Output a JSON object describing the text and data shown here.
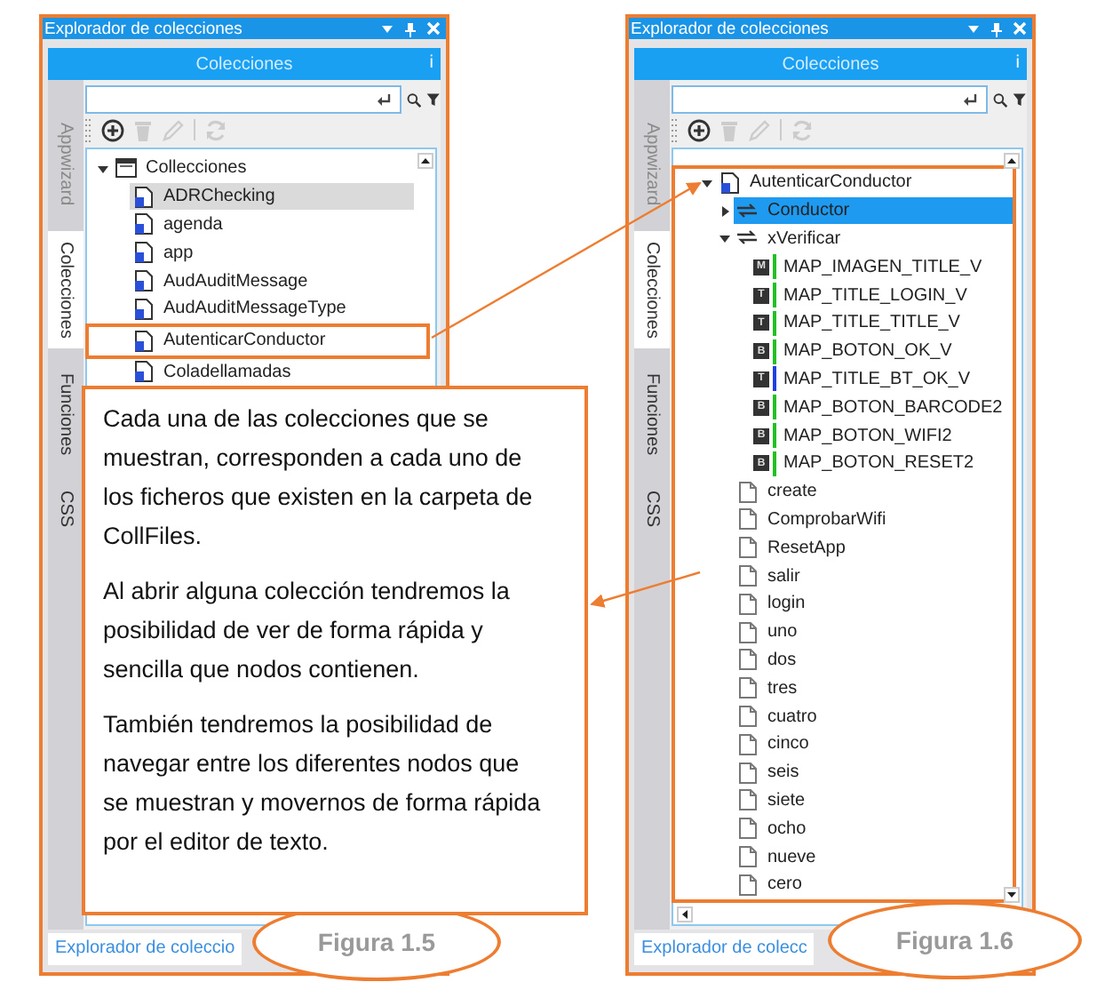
{
  "panels": [
    {
      "title": "Explorador de colecciones",
      "header": "Colecciones",
      "header_info": "i",
      "side_tabs": [
        {
          "label": "Appwizard",
          "selected": false,
          "disabled": true
        },
        {
          "label": "Colecciones",
          "selected": true,
          "disabled": false
        },
        {
          "label": "Funciones",
          "selected": false,
          "disabled": false
        },
        {
          "label": "CSS",
          "selected": false,
          "disabled": false
        }
      ],
      "list_focused": false,
      "tree": [
        {
          "label": "Collecciones",
          "kind": "collection",
          "expanded": true,
          "selected": false,
          "children": [
            {
              "label": "ADRChecking",
              "kind": "document",
              "selected": true
            },
            {
              "label": "agenda",
              "kind": "document",
              "selected": false
            },
            {
              "label": "app",
              "kind": "document",
              "selected": false
            },
            {
              "label": "AudAuditMessage",
              "kind": "document",
              "selected": false
            },
            {
              "label": "AudAuditMessageType",
              "kind": "document",
              "selected": false
            },
            {
              "label": "AutenticarConductor",
              "kind": "document",
              "selected": false,
              "highlighted": true
            },
            {
              "label": "Coladellamadas",
              "kind": "document",
              "selected": false
            }
          ]
        }
      ],
      "footer_tab": "Explorador de coleccio",
      "figure_label": "Figura 1.5"
    },
    {
      "title": "Explorador de colecciones",
      "header": "Colecciones",
      "header_info": "i",
      "side_tabs": [
        {
          "label": "Appwizard",
          "selected": false,
          "disabled": true
        },
        {
          "label": "Colecciones",
          "selected": true,
          "disabled": false
        },
        {
          "label": "Funciones",
          "selected": false,
          "disabled": false
        },
        {
          "label": "CSS",
          "selected": false,
          "disabled": false
        }
      ],
      "list_focused": true,
      "tree": [
        {
          "label": "AutenticarConductor",
          "kind": "document",
          "expanded": true,
          "selected": false,
          "highlighted": true,
          "children": [
            {
              "label": "Conductor",
              "kind": "node",
              "expanded": false,
              "selected": true
            },
            {
              "label": "xVerificar",
              "kind": "node",
              "expanded": true,
              "selected": false,
              "children": [
                {
                  "label": "MAP_IMAGEN_TITLE_V",
                  "kind": "map",
                  "badge": "M",
                  "color": "#22c022",
                  "selected": false
                },
                {
                  "label": "MAP_TITLE_LOGIN_V",
                  "kind": "map",
                  "badge": "T",
                  "color": "#22c022",
                  "selected": false
                },
                {
                  "label": "MAP_TITLE_TITLE_V",
                  "kind": "map",
                  "badge": "T",
                  "color": "#22c022",
                  "selected": false
                },
                {
                  "label": "MAP_BOTON_OK_V",
                  "kind": "map",
                  "badge": "B",
                  "color": "#22c022",
                  "selected": false
                },
                {
                  "label": "MAP_TITLE_BT_OK_V",
                  "kind": "map",
                  "badge": "T",
                  "color": "#2040e0",
                  "selected": false
                },
                {
                  "label": "MAP_BOTON_BARCODE2",
                  "kind": "map",
                  "badge": "B",
                  "color": "#22c022",
                  "selected": false
                },
                {
                  "label": "MAP_BOTON_WIFI2",
                  "kind": "map",
                  "badge": "B",
                  "color": "#22c022",
                  "selected": false
                },
                {
                  "label": "MAP_BOTON_RESET2",
                  "kind": "map",
                  "badge": "B",
                  "color": "#22c022",
                  "selected": false
                }
              ]
            },
            {
              "label": "create",
              "kind": "file",
              "selected": false
            },
            {
              "label": "ComprobarWifi",
              "kind": "file",
              "selected": false
            },
            {
              "label": "ResetApp",
              "kind": "file",
              "selected": false
            },
            {
              "label": "salir",
              "kind": "file",
              "selected": false
            },
            {
              "label": "login",
              "kind": "file",
              "selected": false
            },
            {
              "label": "uno",
              "kind": "file",
              "selected": false
            },
            {
              "label": "dos",
              "kind": "file",
              "selected": false
            },
            {
              "label": "tres",
              "kind": "file",
              "selected": false
            },
            {
              "label": "cuatro",
              "kind": "file",
              "selected": false
            },
            {
              "label": "cinco",
              "kind": "file",
              "selected": false
            },
            {
              "label": "seis",
              "kind": "file",
              "selected": false
            },
            {
              "label": "siete",
              "kind": "file",
              "selected": false
            },
            {
              "label": "ocho",
              "kind": "file",
              "selected": false
            },
            {
              "label": "nueve",
              "kind": "file",
              "selected": false
            },
            {
              "label": "cero",
              "kind": "file",
              "selected": false
            }
          ]
        }
      ],
      "footer_tab": "Explorador de colecc",
      "figure_label": "Figura 1.6"
    }
  ],
  "callout": {
    "paragraphs": [
      "Cada una de las colecciones que se muestran, corresponden a cada uno de los ficheros que existen en la carpeta de CollFiles.",
      "Al abrir alguna colección tendremos la posibilidad de ver de forma rápida y sencilla que nodos contienen.",
      "También tendremos la posibilidad de navegar entre los diferentes nodos que se muestran y movernos de forma rápida por el editor de texto."
    ]
  }
}
